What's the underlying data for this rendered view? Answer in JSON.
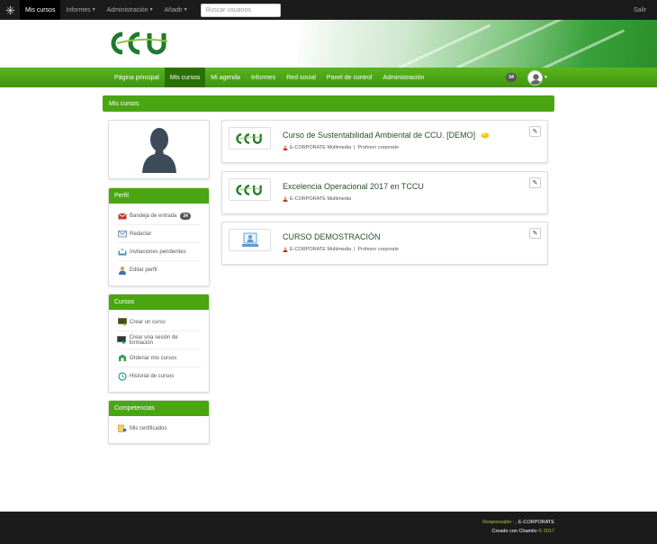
{
  "topbar": {
    "items": [
      {
        "label": "Mis cursos",
        "active": true,
        "caret": false
      },
      {
        "label": "Informes",
        "active": false,
        "caret": true
      },
      {
        "label": "Administración",
        "active": false,
        "caret": true
      },
      {
        "label": "Añadir",
        "active": false,
        "caret": true
      }
    ],
    "search_placeholder": "Buscar usuarios",
    "logout": "Salir"
  },
  "brand": {
    "logo_text": "CCU",
    "accent": "#49a611",
    "dark": "#1b1b1b"
  },
  "nav": {
    "items": [
      {
        "label": "Página principal",
        "active": false
      },
      {
        "label": "Mis cursos",
        "active": true
      },
      {
        "label": "Mi agenda",
        "active": false
      },
      {
        "label": "Informes",
        "active": false
      },
      {
        "label": "Red social",
        "active": false
      },
      {
        "label": "Panel de control",
        "active": false
      },
      {
        "label": "Administración",
        "active": false
      }
    ],
    "notifications": "34"
  },
  "section_title": "Mis cursos",
  "perfil": {
    "title": "Perfil",
    "items": [
      {
        "label": "Bandeja de entrada",
        "icon": "inbox-icon",
        "badge": "34"
      },
      {
        "label": "Redactar",
        "icon": "compose-icon"
      },
      {
        "label": "Invitaciones pendientes",
        "icon": "invitation-icon"
      },
      {
        "label": "Editar perfil",
        "icon": "edit-profile-icon"
      }
    ]
  },
  "cursos": {
    "title": "Cursos",
    "items": [
      {
        "label": "Crear un curso",
        "icon": "create-course-icon"
      },
      {
        "label": "Crear una sesión de formación",
        "icon": "create-session-icon"
      },
      {
        "label": "Ordenar mis cursos",
        "icon": "sort-courses-icon"
      },
      {
        "label": "Historial de cursos",
        "icon": "history-icon"
      }
    ]
  },
  "competencias": {
    "title": "Competencias",
    "items": [
      {
        "label": "Mis certificados",
        "icon": "certificate-icon"
      }
    ]
  },
  "courses": [
    {
      "title": "Curso de Sustentabilidad Ambiental de CCU. [DEMO]",
      "meta1": "E-CORPORATE Multimedia",
      "meta2": "Profesor corporate",
      "thumb": "ccu-logo",
      "has_badge": true
    },
    {
      "title": "Excelencia Operacional 2017 en TCCU",
      "meta1": "E-CORPORATE Multimedia",
      "meta2": "",
      "thumb": "ccu-logo",
      "has_badge": false
    },
    {
      "title": "CURSO DEMOSTRACIÓN",
      "meta1": "E-CORPORATE Multimedia",
      "meta2": "Profesor corporate",
      "thumb": "course-placeholder",
      "has_badge": false
    }
  ],
  "footer": {
    "responsable_label": "Responsable :",
    "responsable_value": ", E-CORPORATE",
    "created_with": "Creado con Chamilo",
    "year": "© 2017"
  }
}
